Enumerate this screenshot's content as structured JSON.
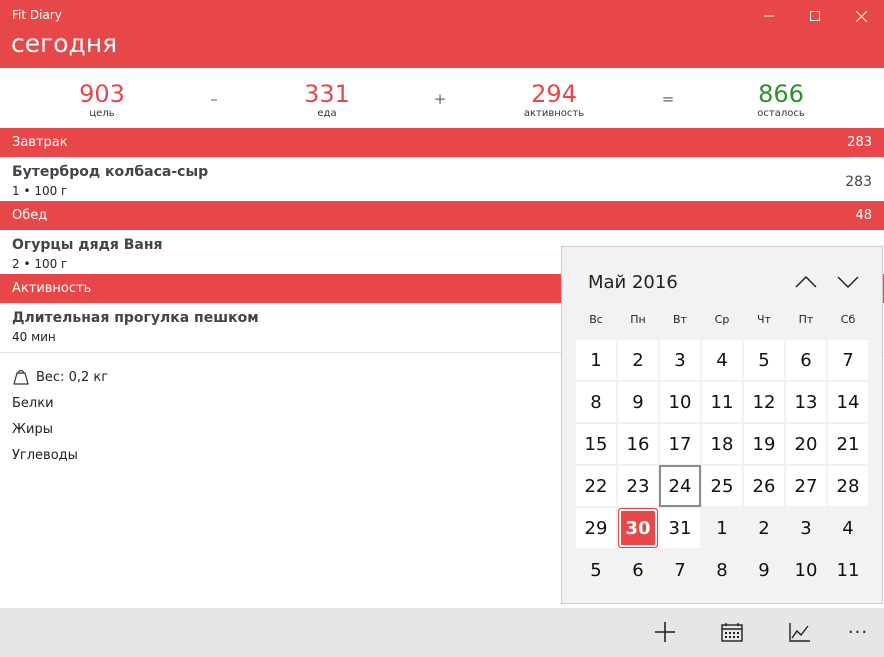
{
  "window": {
    "app_title": "Fit Diary",
    "page_title": "сегодня",
    "controls": {
      "minimize_icon": "minimize-icon",
      "maximize_icon": "maximize-icon",
      "close_icon": "close-icon"
    }
  },
  "summary": {
    "goal": {
      "value": "903",
      "label": "цель"
    },
    "op1": "–",
    "food": {
      "value": "331",
      "label": "еда"
    },
    "op2": "+",
    "activity": {
      "value": "294",
      "label": "активность"
    },
    "op3": "=",
    "remaining": {
      "value": "866",
      "label": "осталось"
    }
  },
  "sections": {
    "breakfast": {
      "name": "Завтрак",
      "total": "283",
      "items": [
        {
          "name": "Бутерброд колбаса-сыр",
          "portion": "1 • 100 г",
          "value": "283"
        }
      ]
    },
    "lunch": {
      "name": "Обед",
      "total": "48",
      "items": [
        {
          "name": "Огурцы дядя Ваня",
          "portion": "2 • 100 г"
        }
      ]
    },
    "activity": {
      "name": "Активность",
      "items": [
        {
          "name": "Длительная прогулка пешком",
          "portion": "40 мин"
        }
      ]
    }
  },
  "stats": {
    "weight": "Вес: 0,2 кг",
    "proteins": "Белки",
    "fats": "Жиры",
    "carbs": "Углеводы"
  },
  "calendar": {
    "month_label": "Май 2016",
    "weekdays": [
      "Вс",
      "Пн",
      "Вт",
      "Ср",
      "Чт",
      "Пт",
      "Сб"
    ],
    "weeks": [
      [
        "1",
        "2",
        "3",
        "4",
        "5",
        "6",
        "7"
      ],
      [
        "8",
        "9",
        "10",
        "11",
        "12",
        "13",
        "14"
      ],
      [
        "15",
        "16",
        "17",
        "18",
        "19",
        "20",
        "21"
      ],
      [
        "22",
        "23",
        "24",
        "25",
        "26",
        "27",
        "28"
      ],
      [
        "29",
        "30",
        "31",
        "1",
        "2",
        "3",
        "4"
      ],
      [
        "5",
        "6",
        "7",
        "8",
        "9",
        "10",
        "11"
      ]
    ],
    "today": "30",
    "highlighted": "24",
    "accent_color": "#e8474a"
  },
  "commandbar": {
    "add_icon": "add-icon",
    "calendar_icon": "calendar-icon",
    "chart_icon": "chart-icon",
    "more_label": "···"
  },
  "colors": {
    "accent": "#e8474a",
    "positive": "#2f8f2f"
  }
}
